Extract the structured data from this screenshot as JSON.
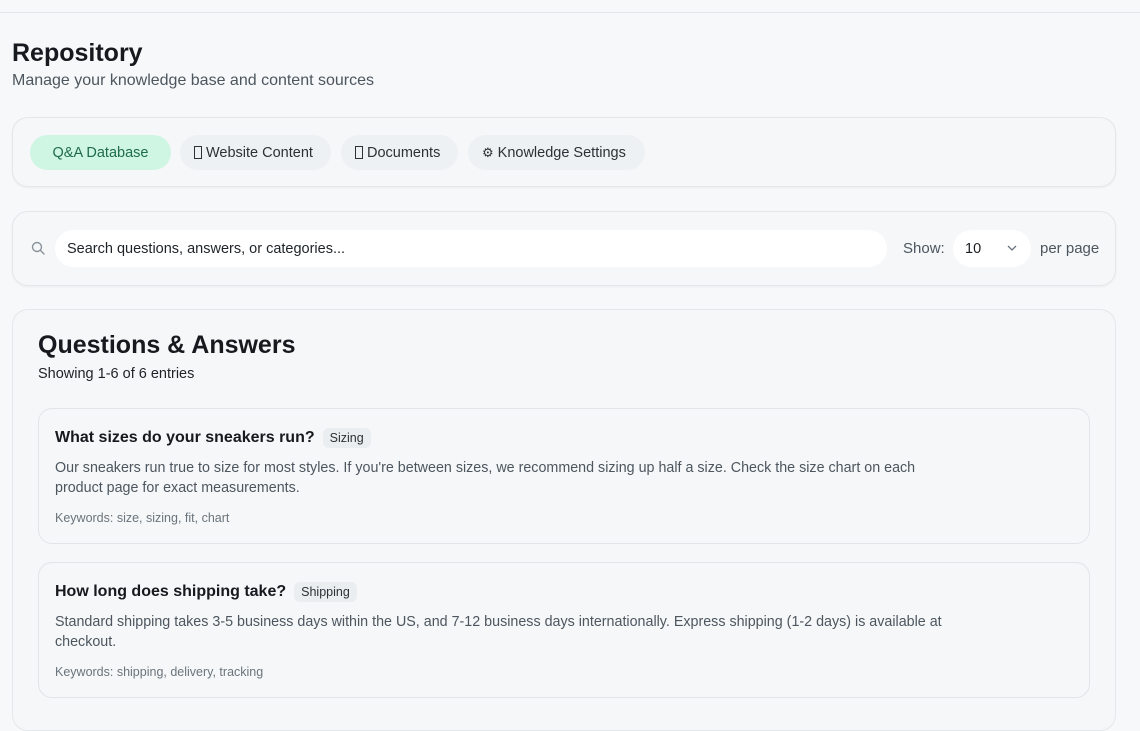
{
  "header": {
    "title": "Repository",
    "subtitle": "Manage your knowledge base and content sources"
  },
  "tabs": [
    {
      "label": "Q&A Database",
      "icon": "none",
      "active": true
    },
    {
      "label": "Website Content",
      "icon": "missing-glyph-icon",
      "active": false
    },
    {
      "label": "Documents",
      "icon": "missing-glyph-icon",
      "active": false
    },
    {
      "label": "Knowledge Settings",
      "icon": "gear-icon",
      "active": false
    }
  ],
  "tab_icons": {
    "gear": "⚙"
  },
  "search": {
    "placeholder": "Search questions, answers, or categories...",
    "show_label": "Show:",
    "per_page_value": "10",
    "per_page_label": "per page"
  },
  "qa": {
    "title": "Questions & Answers",
    "count_text": "Showing 1-6 of 6 entries",
    "items": [
      {
        "question": "What sizes do your sneakers run?",
        "tag": "Sizing",
        "answer": "Our sneakers run true to size for most styles. If you're between sizes, we recommend sizing up half a size. Check the size chart on each product page for exact measurements.",
        "keywords": "Keywords: size, sizing, fit, chart"
      },
      {
        "question": "How long does shipping take?",
        "tag": "Shipping",
        "answer": "Standard shipping takes 3-5 business days within the US, and 7-12 business days internationally. Express shipping (1-2 days) is available at checkout.",
        "keywords": "Keywords: shipping, delivery, tracking"
      }
    ]
  },
  "colors": {
    "accent": "#cff5e3",
    "accent_text": "#1f6b4d",
    "background": "#f6f8f9"
  }
}
